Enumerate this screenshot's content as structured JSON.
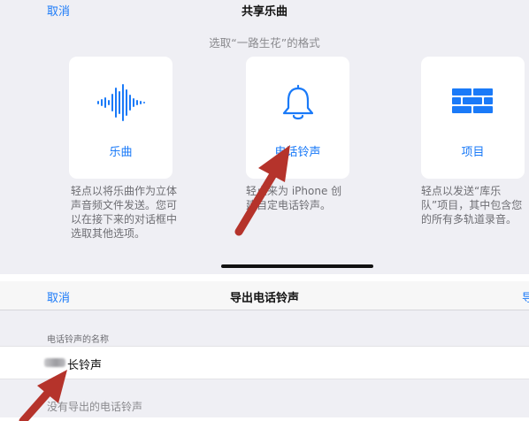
{
  "share_sheet": {
    "cancel_label": "取消",
    "title": "共享乐曲",
    "subtitle": "选取“一路生花”的格式",
    "options": [
      {
        "icon": "waveform-icon",
        "label": "乐曲",
        "description": "轻点以将乐曲作为立体声音频文件发送。您可以在接下来的对话框中选取其他选项。"
      },
      {
        "icon": "bell-icon",
        "label": "电话铃声",
        "description": "轻点来为 iPhone 创建自定电话铃声。"
      },
      {
        "icon": "brick-wall-icon",
        "label": "项目",
        "description": "轻点以发送“库乐队”项目，其中包含您的所有多轨道录音。"
      }
    ]
  },
  "export_ringtone": {
    "cancel_label": "取消",
    "title": "导出电话铃声",
    "right_action_partial": "导",
    "section_header": "电话铃声的名称",
    "name_value": "长铃声",
    "empty_message": "没有导出的电话铃声"
  },
  "colors": {
    "accent": "#1a7af8",
    "annotation_arrow": "#b5332b"
  }
}
